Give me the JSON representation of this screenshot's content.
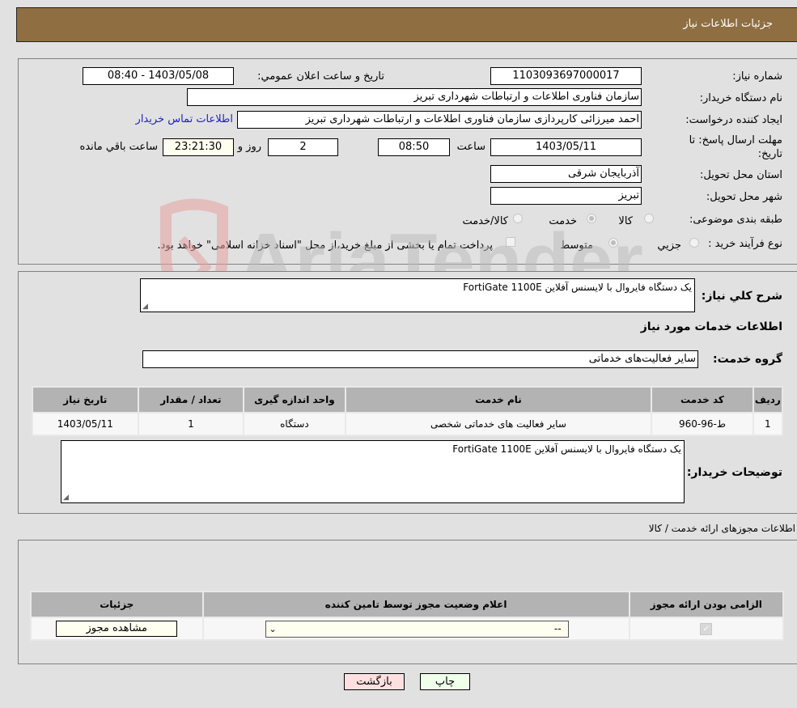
{
  "header": {
    "title": "جزئیات اطلاعات نیاز"
  },
  "details": {
    "need_number_label": "شماره نیاز:",
    "need_number": "1103093697000017",
    "announce_label": "تاریخ و ساعت اعلان عمومي:",
    "announce_value": "1403/05/08 - 08:40",
    "buyer_org_label": "نام دستگاه خریدار:",
    "buyer_org": "سازمان فناوری اطلاعات و ارتباطات شهرداری تبریز",
    "requester_label": "ایجاد کننده درخواست:",
    "requester": "احمد میرزائی کارپردازی سازمان فناوری اطلاعات و ارتباطات شهرداری تبریز",
    "contact_link": "اطلاعات تماس خریدار",
    "deadline_label_1": "مهلت ارسال پاسخ: تا",
    "deadline_label_2": "تاریخ:",
    "deadline_date": "1403/05/11",
    "time_label": "ساعت",
    "deadline_time": "08:50",
    "days_value": "2",
    "days_label": "روز و",
    "remaining_time": "23:21:30",
    "remaining_label": "ساعت باقي مانده",
    "province_label": "استان محل تحویل:",
    "province": "آذربایجان شرقی",
    "city_label": "شهر محل تحویل:",
    "city": "تبریز",
    "category_label": "طبقه بندی موضوعی:",
    "category_options": [
      {
        "label": "کالا",
        "selected": false
      },
      {
        "label": "خدمت",
        "selected": true
      },
      {
        "label": "کالا/خدمت",
        "selected": false
      }
    ],
    "process_label": "نوع فرآیند خرید :",
    "process_options": [
      {
        "label": "جزيي",
        "selected": false
      },
      {
        "label": "متوسط",
        "selected": true
      }
    ],
    "treasury_checkbox_label": "پرداخت تمام یا بخشی از مبلغ خرید،از محل \"اسناد خزانه اسلامی\" خواهد بود."
  },
  "summary": {
    "description_label": "شرح كلي نياز:",
    "description": "یک دستگاه فایروال با لایسنس آفلاین FortiGate 1100E",
    "services_heading": "اطلاعات خدمات مورد نیاز",
    "service_group_label": "گروه خدمت:",
    "service_group": "سایر فعالیت‌های خدماتی"
  },
  "services_table": {
    "columns": [
      "ردیف",
      "کد خدمت",
      "نام خدمت",
      "واحد اندازه گیری",
      "تعداد / مقدار",
      "تاریخ نیاز"
    ],
    "rows": [
      [
        "1",
        "ط-96-960",
        "سایر فعالیت های خدماتی شخصی",
        "دستگاه",
        "1",
        "1403/05/11"
      ]
    ]
  },
  "buyer_notes": {
    "label": "توضیحات خریدار:",
    "value": "یک دستگاه فایروال با لایسنس آفلاین FortiGate 1100E"
  },
  "permits": {
    "heading": "اطلاعات مجوزهای ارائه خدمت / کالا",
    "columns": [
      "الزامی بودن ارائه مجوز",
      "اعلام وضعیت مجوز توسط تامین کننده",
      "جزئیات"
    ],
    "row": {
      "required_checked": true,
      "status_selected": "--",
      "view_button": "مشاهده مجوز"
    }
  },
  "footer": {
    "print_button": "چاپ",
    "back_button": "بازگشت"
  },
  "watermark": {
    "text": "AriaTender.neT"
  }
}
